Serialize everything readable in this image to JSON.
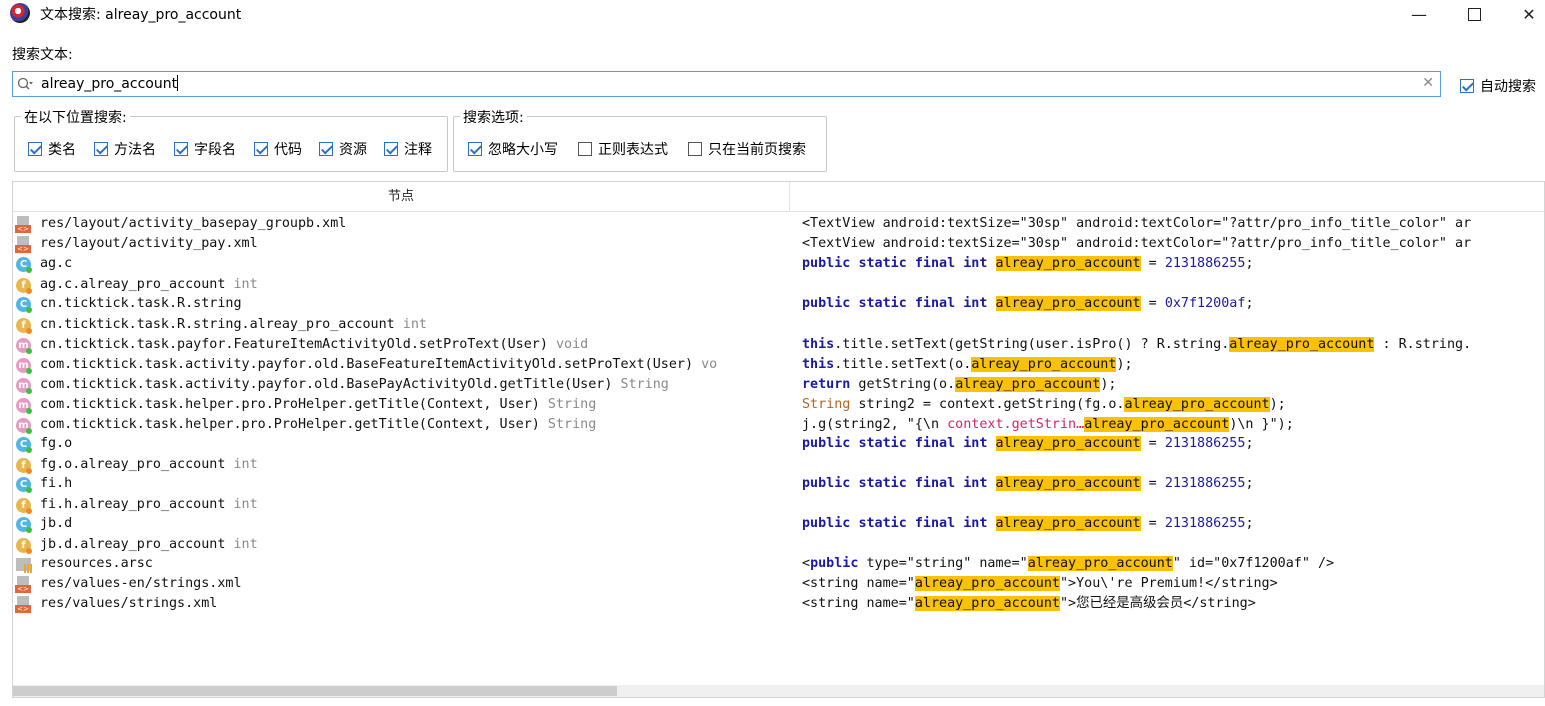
{
  "window": {
    "title": "文本搜索: alreay_pro_account"
  },
  "search": {
    "label": "搜索文本:",
    "value": "alreay_pro_account",
    "auto_search_label": "自动搜索"
  },
  "location_group": {
    "title": "在以下位置搜索:",
    "options": [
      {
        "label": "类名",
        "checked": true
      },
      {
        "label": "方法名",
        "checked": true
      },
      {
        "label": "字段名",
        "checked": true
      },
      {
        "label": "代码",
        "checked": true
      },
      {
        "label": "资源",
        "checked": true
      },
      {
        "label": "注释",
        "checked": true
      }
    ]
  },
  "options_group": {
    "title": "搜索选项:",
    "options": [
      {
        "label": "忽略大小写",
        "checked": true
      },
      {
        "label": "正则表达式",
        "checked": false
      },
      {
        "label": "只在当前页搜索",
        "checked": false
      }
    ]
  },
  "results": {
    "column_node": "节点",
    "rows": [
      {
        "icon": "xml-file-icon",
        "name": "res/layout/activity_basepay_groupb.xml",
        "type": ""
      },
      {
        "icon": "xml-file-icon",
        "name": "res/layout/activity_pay.xml",
        "type": ""
      },
      {
        "icon": "class-icon",
        "name": "ag.c",
        "type": ""
      },
      {
        "icon": "field-icon",
        "name": "ag.c.alreay_pro_account",
        "type": "int"
      },
      {
        "icon": "class-icon",
        "name": "cn.ticktick.task.R.string",
        "type": ""
      },
      {
        "icon": "field-icon",
        "name": "cn.ticktick.task.R.string.alreay_pro_account",
        "type": "int"
      },
      {
        "icon": "method-icon",
        "name": "cn.ticktick.task.payfor.FeatureItemActivityOld.setProText(User)",
        "type": "void"
      },
      {
        "icon": "method-icon",
        "name": "com.ticktick.task.activity.payfor.old.BaseFeatureItemActivityOld.setProText(User)",
        "type": "vo"
      },
      {
        "icon": "method-icon",
        "name": "com.ticktick.task.activity.payfor.old.BasePayActivityOld.getTitle(User)",
        "type": "String"
      },
      {
        "icon": "method-icon",
        "name": "com.ticktick.task.helper.pro.ProHelper.getTitle(Context, User)",
        "type": "String"
      },
      {
        "icon": "method-icon",
        "name": "com.ticktick.task.helper.pro.ProHelper.getTitle(Context, User)",
        "type": "String"
      },
      {
        "icon": "class-icon",
        "name": "fg.o",
        "type": ""
      },
      {
        "icon": "field-icon",
        "name": "fg.o.alreay_pro_account",
        "type": "int"
      },
      {
        "icon": "class-icon",
        "name": "fi.h",
        "type": ""
      },
      {
        "icon": "field-icon",
        "name": "fi.h.alreay_pro_account",
        "type": "int"
      },
      {
        "icon": "class-icon",
        "name": "jb.d",
        "type": ""
      },
      {
        "icon": "field-icon",
        "name": "jb.d.alreay_pro_account",
        "type": "int"
      },
      {
        "icon": "arsc-file-icon",
        "name": "resources.arsc",
        "type": ""
      },
      {
        "icon": "xml-file-icon",
        "name": "res/values-en/strings.xml",
        "type": ""
      },
      {
        "icon": "xml-file-icon",
        "name": "res/values/strings.xml",
        "type": ""
      }
    ],
    "code_lines": [
      "<TextView android:textSize=\"30sp\" android:textColor=\"?attr/pro_info_title_color\" ar",
      "<TextView android:textSize=\"30sp\" android:textColor=\"?attr/pro_info_title_color\" ar",
      "public static final int alreay_pro_account = 2131886255;",
      "",
      "public static final int alreay_pro_account = 0x7f1200af;",
      "",
      "this.title.setText(getString(user.isPro() ? R.string.alreay_pro_account : R.string.",
      "this.title.setText(o.alreay_pro_account);",
      "return getString(o.alreay_pro_account);",
      "String string2 = context.getString(fg.o.alreay_pro_account);",
      "j.g(string2, \"{\\n      context.getStrin…alreay_pro_account)\\n    }\");",
      "public static final int alreay_pro_account = 2131886255;",
      "",
      "public static final int alreay_pro_account = 2131886255;",
      "",
      "public static final int alreay_pro_account = 2131886255;",
      "",
      "<public type=\"string\" name=\"alreay_pro_account\" id=\"0x7f1200af\" />",
      "<string name=\"alreay_pro_account\">You\\'re Premium!</string>",
      "<string name=\"alreay_pro_account\">您已经是高级会员</string>"
    ]
  },
  "colors": {
    "highlight": "#f9c209",
    "keyword": "#1a1aa6",
    "accent": "#2a6fc9"
  }
}
